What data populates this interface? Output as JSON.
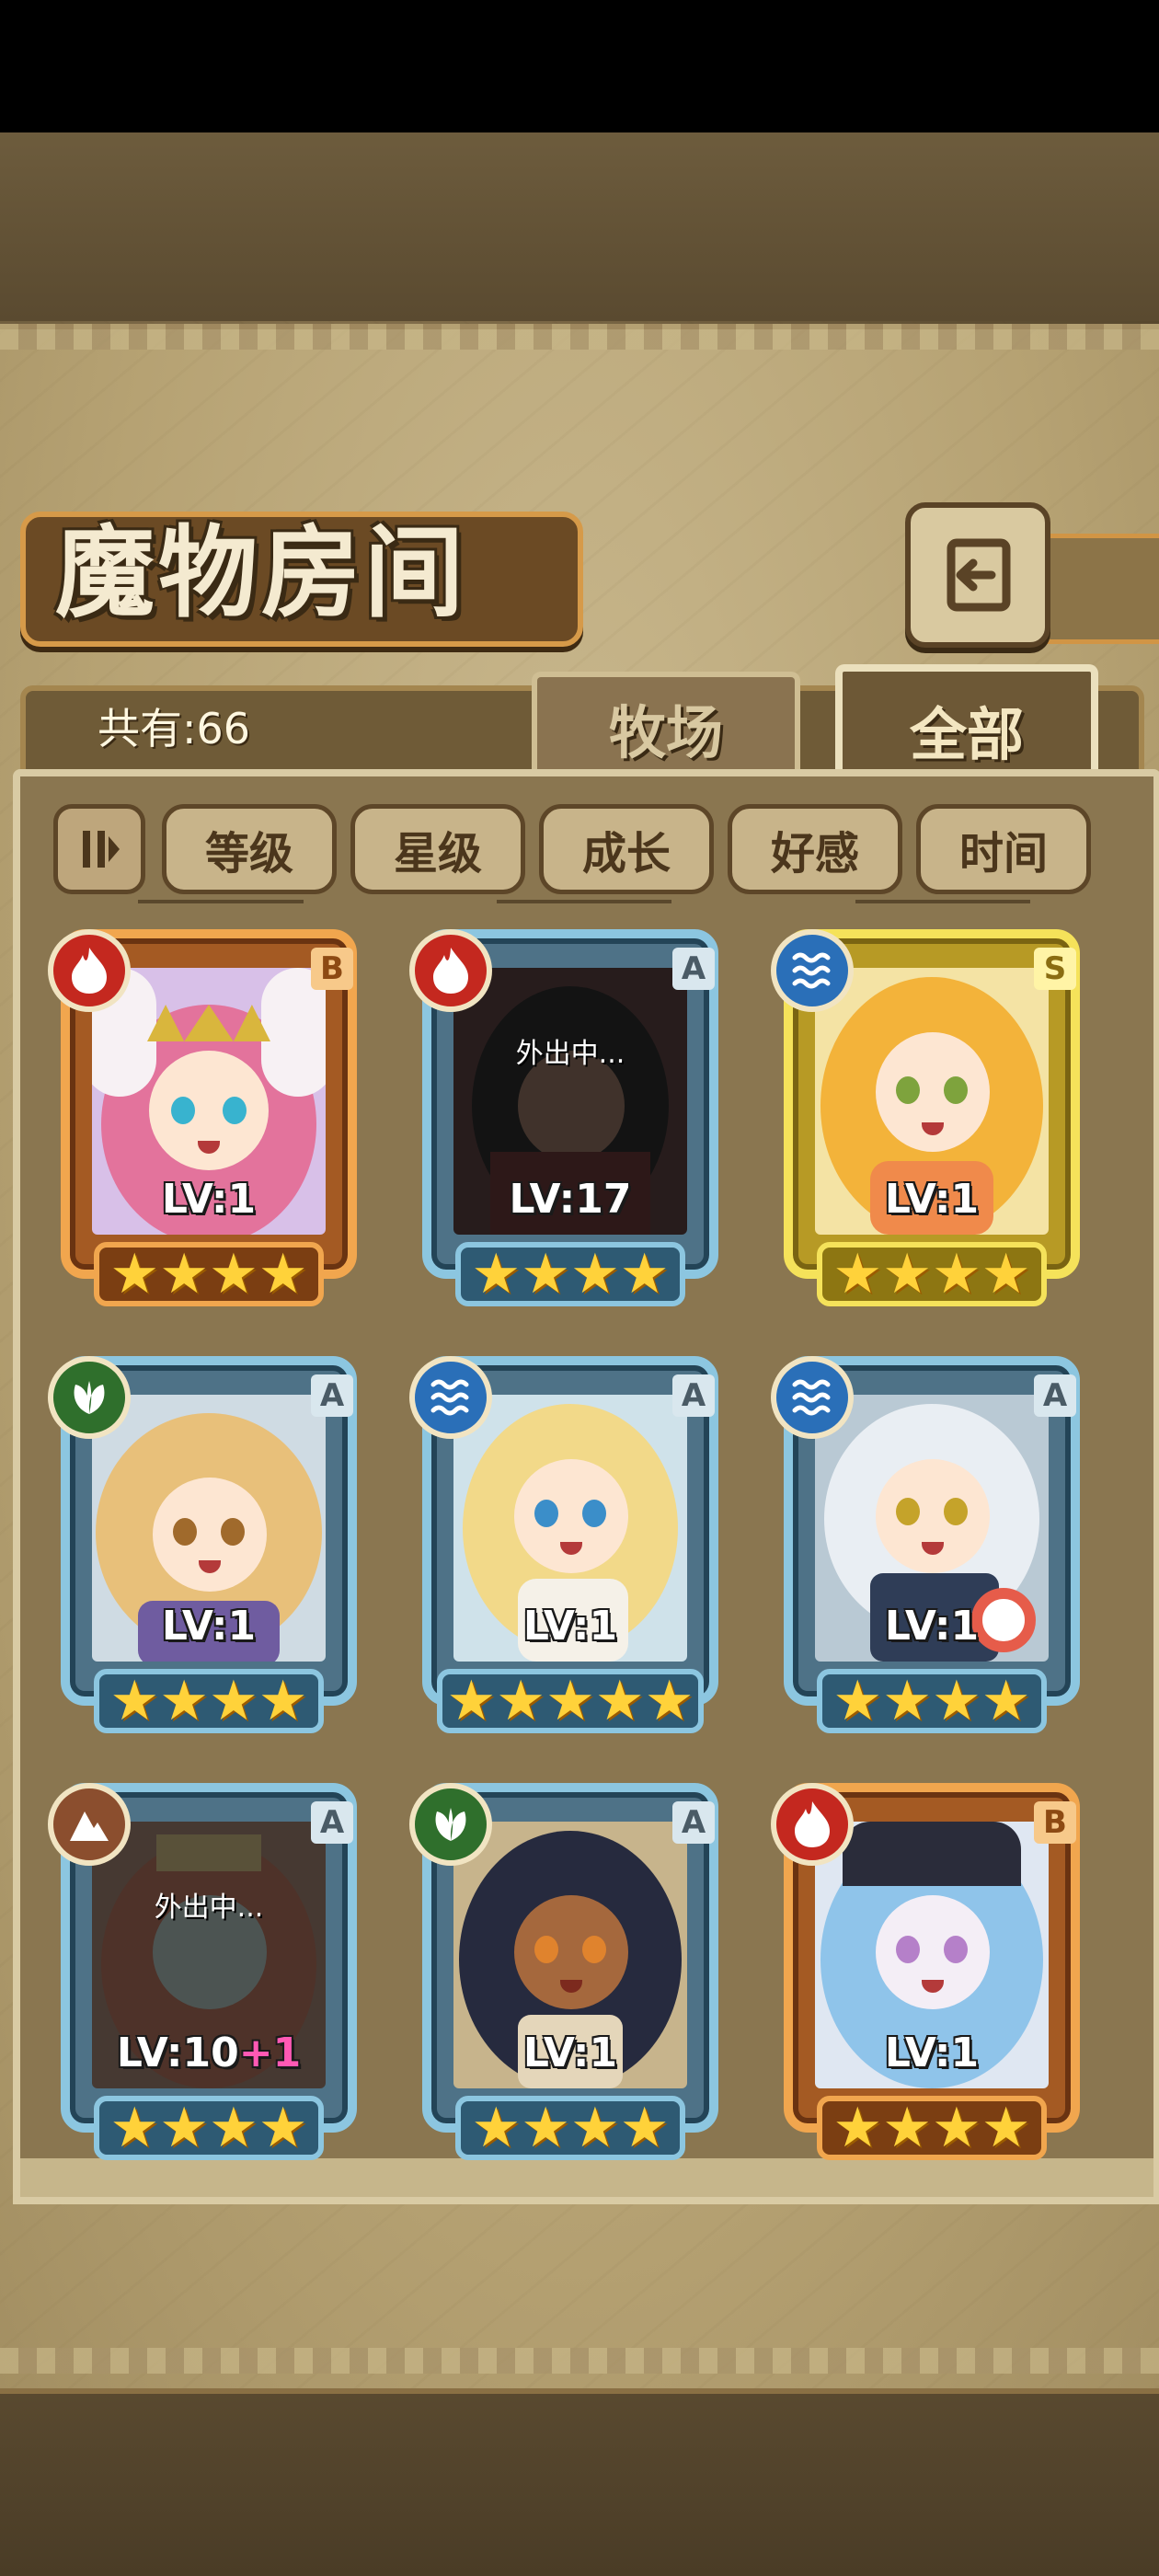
{
  "title": "魔物房间",
  "total_count_label": "共有:66",
  "tabs": [
    {
      "label": "牧场"
    },
    {
      "label": "全部",
      "active": true
    }
  ],
  "sort": {
    "toggle_icon": "sort-order-icon",
    "buttons": [
      {
        "label": "等级"
      },
      {
        "label": "星级"
      },
      {
        "label": "成长"
      },
      {
        "label": "好感"
      },
      {
        "label": "时间"
      }
    ]
  },
  "cards": [
    {
      "element": "fire",
      "grade": "B",
      "frame": "orange",
      "level": "LV:1",
      "level_bonus": "",
      "stars": 4,
      "away": ""
    },
    {
      "element": "fire",
      "grade": "A",
      "frame": "blue",
      "level": "LV:17",
      "level_bonus": "",
      "stars": 4,
      "away": "外出中..."
    },
    {
      "element": "water",
      "grade": "S",
      "frame": "gold",
      "level": "LV:1",
      "level_bonus": "",
      "stars": 4,
      "away": ""
    },
    {
      "element": "grass",
      "grade": "A",
      "frame": "blue",
      "level": "LV:1",
      "level_bonus": "",
      "stars": 4,
      "away": ""
    },
    {
      "element": "water",
      "grade": "A",
      "frame": "blue",
      "level": "LV:1",
      "level_bonus": "",
      "stars": 5,
      "away": ""
    },
    {
      "element": "water",
      "grade": "A",
      "frame": "blue",
      "level": "LV:1",
      "level_bonus": "",
      "stars": 4,
      "away": ""
    },
    {
      "element": "earth",
      "grade": "A",
      "frame": "blue",
      "level": "LV:10",
      "level_bonus": "+1",
      "stars": 4,
      "away": "外出中..."
    },
    {
      "element": "grass",
      "grade": "A",
      "frame": "blue",
      "level": "LV:1",
      "level_bonus": "",
      "stars": 4,
      "away": ""
    },
    {
      "element": "fire",
      "grade": "B",
      "frame": "orange",
      "level": "LV:1",
      "level_bonus": "",
      "stars": 4,
      "away": ""
    }
  ],
  "colors": {
    "fire": "#c4281f",
    "water": "#2a6fb8",
    "grass": "#2f6f2c",
    "earth": "#8b4e2e",
    "star": "#ffd23a"
  }
}
